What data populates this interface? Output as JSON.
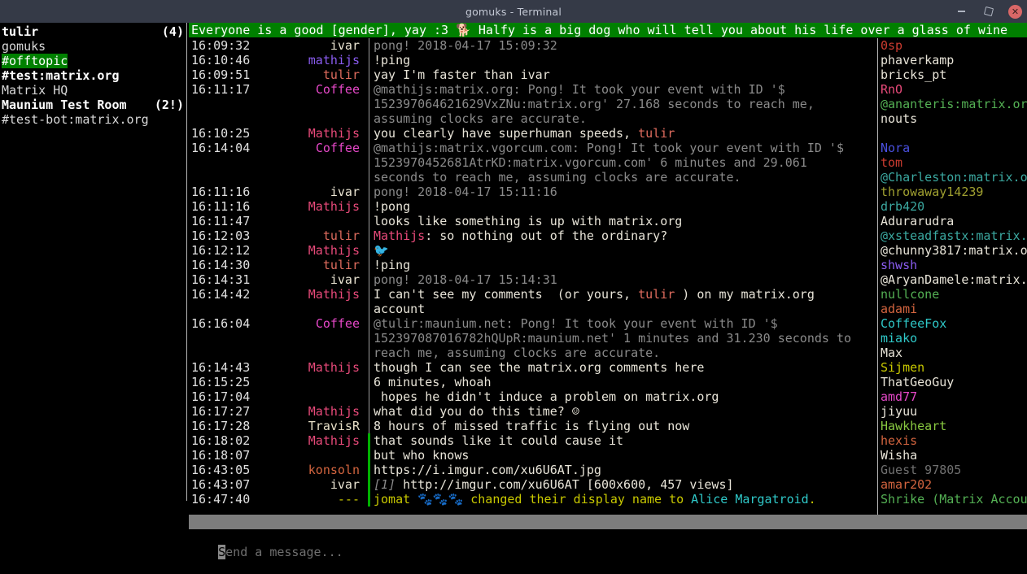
{
  "window": {
    "title": "gomuks - Terminal",
    "minimize_label": "–",
    "maximize_label": "❐",
    "close_label": "×"
  },
  "roomlist": {
    "items": [
      {
        "name": "tulir",
        "count": "(4)",
        "bold": true,
        "selected": false
      },
      {
        "name": "gomuks",
        "count": "",
        "bold": false,
        "selected": false
      },
      {
        "name": "#offtopic",
        "count": "",
        "bold": false,
        "selected": true
      },
      {
        "name": "#test:matrix.org",
        "count": "",
        "bold": true,
        "selected": false
      },
      {
        "name": "Matrix HQ",
        "count": "",
        "bold": false,
        "selected": false
      },
      {
        "name": "Maunium Test Room",
        "count": "(2!)",
        "bold": true,
        "selected": false
      },
      {
        "name": "#test-bot:matrix.org",
        "count": "",
        "bold": false,
        "selected": false
      }
    ]
  },
  "topic": {
    "text": "Everyone is a good [gender], yay :3 🐕 Halfy is a big dog who will tell you about his life over a glass of wine",
    "background_color": "#008000",
    "text_color": "#ffffff"
  },
  "messages": [
    {
      "ts": "16:09:32",
      "sender": "ivar",
      "sender_color": "c-cream",
      "unread": false,
      "parts": [
        {
          "t": "pong! 2018-04-17 15:09:32",
          "c": "c-dim"
        }
      ]
    },
    {
      "ts": "16:10:46",
      "sender": "mathijs",
      "sender_color": "c-purple",
      "unread": false,
      "parts": [
        {
          "t": "!ping",
          "c": "c-white"
        }
      ]
    },
    {
      "ts": "16:09:51",
      "sender": "tulir",
      "sender_color": "c-salmon",
      "unread": false,
      "parts": [
        {
          "t": "yay I'm faster than ivar",
          "c": "c-white"
        }
      ]
    },
    {
      "ts": "16:11:17",
      "sender": "Coffee",
      "sender_color": "c-magenta",
      "unread": false,
      "parts": [
        {
          "t": "@mathijs:matrix.org: Pong! It took your event with ID '$",
          "c": "c-dim"
        }
      ]
    },
    {
      "ts": "",
      "sender": "",
      "sender_color": "",
      "unread": false,
      "parts": [
        {
          "t": "152397064621629VxZNu:matrix.org' 27.168 seconds to reach me,",
          "c": "c-dim"
        }
      ]
    },
    {
      "ts": "",
      "sender": "",
      "sender_color": "",
      "unread": false,
      "parts": [
        {
          "t": "assuming clocks are accurate.",
          "c": "c-dim"
        }
      ]
    },
    {
      "ts": "16:10:25",
      "sender": "Mathijs",
      "sender_color": "c-pink",
      "unread": false,
      "parts": [
        {
          "t": "you clearly have superhuman speeds, ",
          "c": "c-white"
        },
        {
          "t": "tulir",
          "c": "c-salmon"
        }
      ]
    },
    {
      "ts": "16:14:04",
      "sender": "Coffee",
      "sender_color": "c-magenta",
      "unread": false,
      "parts": [
        {
          "t": "@mathijs:matrix.vgorcum.com: Pong! It took your event with ID '$",
          "c": "c-dim"
        }
      ]
    },
    {
      "ts": "",
      "sender": "",
      "sender_color": "",
      "unread": false,
      "parts": [
        {
          "t": "1523970452681AtrKD:matrix.vgorcum.com' 6 minutes and 29.061",
          "c": "c-dim"
        }
      ]
    },
    {
      "ts": "",
      "sender": "",
      "sender_color": "",
      "unread": false,
      "parts": [
        {
          "t": "seconds to reach me, assuming clocks are accurate.",
          "c": "c-dim"
        }
      ]
    },
    {
      "ts": "16:11:16",
      "sender": "ivar",
      "sender_color": "c-cream",
      "unread": false,
      "parts": [
        {
          "t": "pong! 2018-04-17 15:11:16",
          "c": "c-dim"
        }
      ]
    },
    {
      "ts": "16:11:16",
      "sender": "Mathijs",
      "sender_color": "c-pink",
      "unread": false,
      "parts": [
        {
          "t": "!pong",
          "c": "c-white"
        }
      ]
    },
    {
      "ts": "16:11:47",
      "sender": "",
      "sender_color": "",
      "unread": false,
      "parts": [
        {
          "t": "looks like something is up with matrix.org",
          "c": "c-white"
        }
      ]
    },
    {
      "ts": "16:12:03",
      "sender": "tulir",
      "sender_color": "c-salmon",
      "unread": false,
      "parts": [
        {
          "t": "Mathijs",
          "c": "c-pink"
        },
        {
          "t": ": so nothing out of the ordinary?",
          "c": "c-white"
        }
      ]
    },
    {
      "ts": "16:12:12",
      "sender": "Mathijs",
      "sender_color": "c-pink",
      "unread": false,
      "parts": [
        {
          "t": "🐦",
          "c": "c-white"
        }
      ]
    },
    {
      "ts": "16:14:30",
      "sender": "tulir",
      "sender_color": "c-salmon",
      "unread": false,
      "parts": [
        {
          "t": "!ping",
          "c": "c-white"
        }
      ]
    },
    {
      "ts": "16:14:31",
      "sender": "ivar",
      "sender_color": "c-cream",
      "unread": false,
      "parts": [
        {
          "t": "pong! 2018-04-17 15:14:31",
          "c": "c-dim"
        }
      ]
    },
    {
      "ts": "16:14:42",
      "sender": "Mathijs",
      "sender_color": "c-pink",
      "unread": false,
      "parts": [
        {
          "t": "I can't see my comments  (or yours, ",
          "c": "c-white"
        },
        {
          "t": "tulir",
          "c": "c-salmon"
        },
        {
          "t": " ) on my matrix.org",
          "c": "c-white"
        }
      ]
    },
    {
      "ts": "",
      "sender": "",
      "sender_color": "",
      "unread": false,
      "parts": [
        {
          "t": "account",
          "c": "c-white"
        }
      ]
    },
    {
      "ts": "16:16:04",
      "sender": "Coffee",
      "sender_color": "c-magenta",
      "unread": false,
      "parts": [
        {
          "t": "@tulir:maunium.net: Pong! It took your event with ID '$",
          "c": "c-dim"
        }
      ]
    },
    {
      "ts": "",
      "sender": "",
      "sender_color": "",
      "unread": false,
      "parts": [
        {
          "t": "152397087016782hQUpR:maunium.net' 1 minutes and 31.230 seconds to",
          "c": "c-dim"
        }
      ]
    },
    {
      "ts": "",
      "sender": "",
      "sender_color": "",
      "unread": false,
      "parts": [
        {
          "t": "reach me, assuming clocks are accurate.",
          "c": "c-dim"
        }
      ]
    },
    {
      "ts": "16:14:43",
      "sender": "Mathijs",
      "sender_color": "c-pink",
      "unread": false,
      "parts": [
        {
          "t": "though I can see the matrix.org comments here",
          "c": "c-white"
        }
      ]
    },
    {
      "ts": "16:15:25",
      "sender": "",
      "sender_color": "",
      "unread": false,
      "parts": [
        {
          "t": "6 minutes, whoah",
          "c": "c-white"
        }
      ]
    },
    {
      "ts": "16:17:04",
      "sender": "",
      "sender_color": "",
      "unread": false,
      "parts": [
        {
          "t": " hopes he didn't induce a problem on matrix.org",
          "c": "c-white"
        }
      ]
    },
    {
      "ts": "16:17:27",
      "sender": "Mathijs",
      "sender_color": "c-pink",
      "unread": false,
      "parts": [
        {
          "t": "what did you do this time? ☺",
          "c": "c-white"
        }
      ]
    },
    {
      "ts": "16:17:28",
      "sender": "TravisR",
      "sender_color": "c-tan",
      "unread": false,
      "parts": [
        {
          "t": "8 hours of missed traffic is flying out now",
          "c": "c-white"
        }
      ]
    },
    {
      "ts": "16:18:02",
      "sender": "Mathijs",
      "sender_color": "c-pink",
      "unread": true,
      "parts": [
        {
          "t": "that sounds like it could cause it",
          "c": "c-white"
        }
      ]
    },
    {
      "ts": "16:18:07",
      "sender": "",
      "sender_color": "",
      "unread": true,
      "parts": [
        {
          "t": "but who knows",
          "c": "c-white"
        }
      ]
    },
    {
      "ts": "16:43:05",
      "sender": "konsoln",
      "sender_color": "c-orange",
      "unread": true,
      "parts": [
        {
          "t": "https://i.imgur.com/xu6U6AT.jpg",
          "c": "c-white"
        }
      ]
    },
    {
      "ts": "16:43:07",
      "sender": "ivar",
      "sender_color": "c-cream",
      "unread": true,
      "parts": [
        {
          "t": "[1]",
          "c": "c-dim ital"
        },
        {
          "t": " http://imgur.com/xu6U6AT [600x600, 457 views]",
          "c": "c-white"
        }
      ]
    },
    {
      "ts": "16:47:40",
      "sender": "---",
      "sender_color": "c-yellow",
      "unread": true,
      "separator": true,
      "parts": [
        {
          "t": "jomat 🐾🐾🐾 changed their display name to ",
          "c": "c-yellow"
        },
        {
          "t": "Alice Margatroid",
          "c": "c-cyan"
        },
        {
          "t": ".",
          "c": "c-yellow"
        }
      ]
    }
  ],
  "members": [
    {
      "name": "0sp",
      "color": "c-red"
    },
    {
      "name": "phaverkamp",
      "color": "c-white"
    },
    {
      "name": "bricks_pt",
      "color": "c-white"
    },
    {
      "name": "RnO",
      "color": "c-pink"
    },
    {
      "name": "@ananteris:matrix.or",
      "color": "c-green"
    },
    {
      "name": "nouts",
      "color": "c-white"
    },
    {
      "name": "",
      "color": "c-white"
    },
    {
      "name": "Nora",
      "color": "c-blue"
    },
    {
      "name": "tom",
      "color": "c-red"
    },
    {
      "name": "@Charleston:matrix.o",
      "color": "c-teal"
    },
    {
      "name": "throwaway14239",
      "color": "c-olive"
    },
    {
      "name": "drb420",
      "color": "c-teal"
    },
    {
      "name": "Adurarudra",
      "color": "c-white"
    },
    {
      "name": "@xsteadfastx:matrix.",
      "color": "c-teal"
    },
    {
      "name": "@chunny3817:matrix.o",
      "color": "c-white"
    },
    {
      "name": "shwsh",
      "color": "c-purple"
    },
    {
      "name": "@AryanDamele:matrix.",
      "color": "c-white"
    },
    {
      "name": "nullcone",
      "color": "c-green"
    },
    {
      "name": "adami",
      "color": "c-orange"
    },
    {
      "name": "CoffeeFox",
      "color": "c-cyan"
    },
    {
      "name": "miako",
      "color": "c-cyan"
    },
    {
      "name": "Max",
      "color": "c-white"
    },
    {
      "name": "Sijmen",
      "color": "c-yellow"
    },
    {
      "name": "ThatGeoGuy",
      "color": "c-white"
    },
    {
      "name": "amd77",
      "color": "c-magenta"
    },
    {
      "name": "jiyuu",
      "color": "c-white"
    },
    {
      "name": "Hawkheart",
      "color": "c-lime"
    },
    {
      "name": "hexis",
      "color": "c-orange"
    },
    {
      "name": "Wisha",
      "color": "c-white"
    },
    {
      "name": "Guest 97805",
      "color": "c-grey"
    },
    {
      "name": "amar202",
      "color": "c-orange"
    },
    {
      "name": "Shrike (Matrix Accou",
      "color": "c-green"
    }
  ],
  "composer": {
    "cursor_char": "S",
    "placeholder_rest": "end a message..."
  }
}
